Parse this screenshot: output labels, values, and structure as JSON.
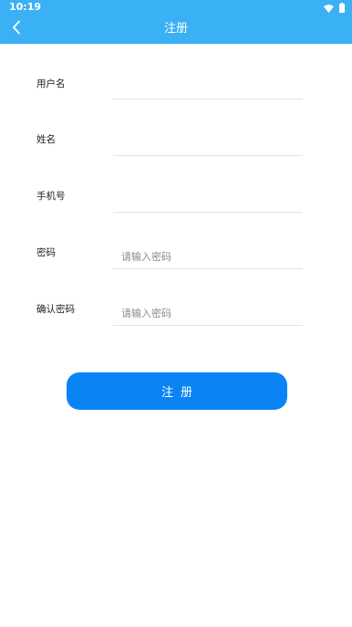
{
  "status_bar": {
    "time": "10:19",
    "icons": [
      "wifi-icon",
      "battery-icon"
    ]
  },
  "app_bar": {
    "back_icon": "chevron-left-icon",
    "title": "注册"
  },
  "form": {
    "username": {
      "label": "用户名",
      "value": "",
      "placeholder": ""
    },
    "name": {
      "label": "姓名",
      "value": "",
      "placeholder": ""
    },
    "phone": {
      "label": "手机号",
      "value": "",
      "placeholder": ""
    },
    "password": {
      "label": "密码",
      "value": "",
      "placeholder": "请输入密码"
    },
    "confirm_password": {
      "label": "确认密码",
      "value": "",
      "placeholder": "请输入密码"
    }
  },
  "submit_label": "注册",
  "colors": {
    "header": "#3ab0f5",
    "button": "#0a84f5"
  }
}
